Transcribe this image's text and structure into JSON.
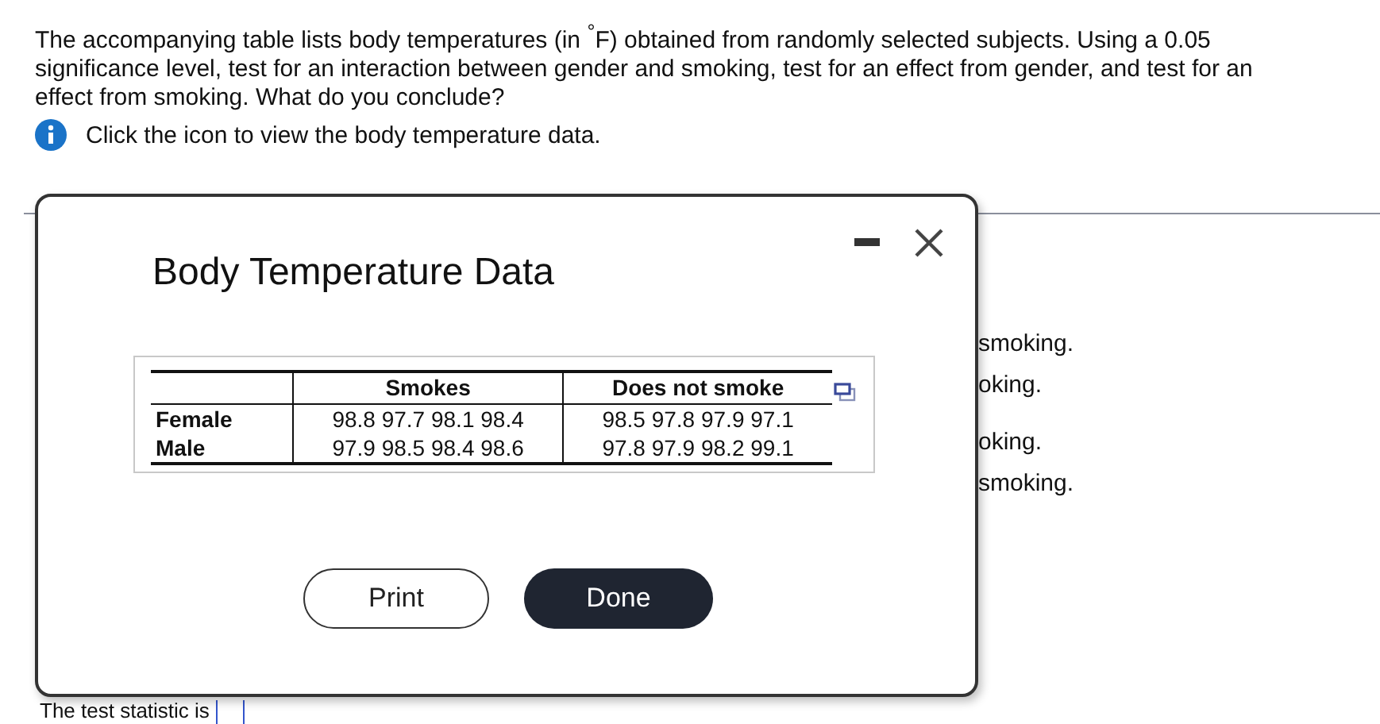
{
  "question": "The accompanying table lists body temperatures (in $^{°}$F) obtained from randomly selected subjects. Using a 0.05 significance level, test for an interaction between gender and smoking, test for an effect from gender, and test for an effect from smoking. What do you conclude?",
  "info": "Click the icon to view the body temperature data.",
  "behind_options": [
    "smoking.",
    "oking.",
    "oking.",
    "smoking."
  ],
  "bottom_text": "The test statistic is",
  "dialog": {
    "title": "Body Temperature Data",
    "table": {
      "columns": [
        "Smokes",
        "Does not smoke"
      ],
      "rows": [
        {
          "label": "Female",
          "cells": [
            "98.8 97.7 98.1 98.4",
            "98.5 97.8 97.9 97.1"
          ]
        },
        {
          "label": "Male",
          "cells": [
            "97.9 98.5 98.4 98.6",
            "97.8 97.9 98.2 99.1"
          ]
        }
      ]
    },
    "buttons": [
      {
        "label": "Print",
        "kind": "secondary"
      },
      {
        "label": "Done",
        "kind": "primary"
      }
    ]
  }
}
